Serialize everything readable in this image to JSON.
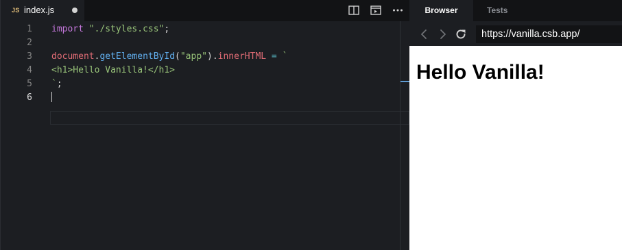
{
  "editor": {
    "tab": {
      "lang_badge": "JS",
      "filename": "index.js"
    },
    "toolbar": {
      "split": "split-editor-icon",
      "preview": "open-preview-icon",
      "more": "more-icon"
    },
    "lines": [
      {
        "number": "1"
      },
      {
        "number": "2"
      },
      {
        "number": "3"
      },
      {
        "number": "4"
      },
      {
        "number": "5"
      },
      {
        "number": "6"
      }
    ],
    "code": {
      "l1_import": "import",
      "l1_str": "\"./styles.css\"",
      "l1_end": ";",
      "l3_doc": "document",
      "l3_dot1": ".",
      "l3_fn": "getElementById",
      "l3_open": "(",
      "l3_arg": "\"app\"",
      "l3_close": ").",
      "l3_prop": "innerHTML",
      "l3_eq": " = ",
      "l3_tick": "`",
      "l4_html": "<h1>Hello Vanilla!</h1>",
      "l5_tick": "`",
      "l5_end": ";"
    },
    "colors": {
      "keyword": "#c678dd",
      "string": "#98c379",
      "identifier": "#e06c75",
      "function": "#61afef",
      "operator": "#56b6c2"
    }
  },
  "browser": {
    "tabs": [
      {
        "label": "Browser",
        "active": true
      },
      {
        "label": "Tests",
        "active": false
      }
    ],
    "url": "https://vanilla.csb.app/",
    "page_heading": "Hello Vanilla!"
  }
}
